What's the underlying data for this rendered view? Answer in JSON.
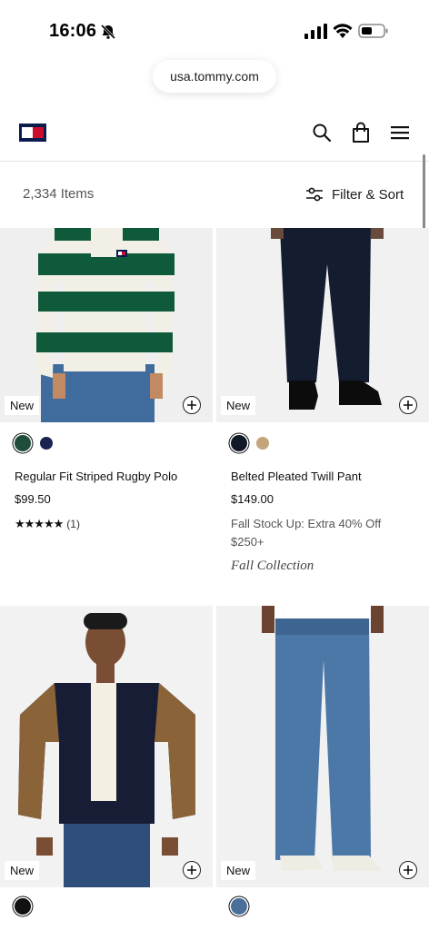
{
  "status_bar": {
    "time": "16:06"
  },
  "browser": {
    "url": "usa.tommy.com"
  },
  "header": {
    "logo": "tommy-hilfiger-flag",
    "icons": [
      "search-icon",
      "bag-icon",
      "menu-icon"
    ]
  },
  "toolbar": {
    "item_count": "2,334 Items",
    "filter_label": "Filter & Sort"
  },
  "colors": {
    "brand_navy": "#0b1b4d",
    "brand_red": "#cc0c2f",
    "green_stripe": "#0f5a3a"
  },
  "products": [
    {
      "badge": "New",
      "title": "Regular Fit Striped Rugby Polo",
      "price": "$99.50",
      "stars": "★★★★★",
      "review_count": "(1)",
      "swatches": [
        "#1e4d3a",
        "#1b2350"
      ]
    },
    {
      "badge": "New",
      "title": "Belted Pleated Twill Pant",
      "price": "$149.00",
      "promo": "Fall Stock Up: Extra 40% Off $250+",
      "collection": "Fall Collection",
      "swatches": [
        "#111827",
        "#c3a47c"
      ]
    },
    {
      "badge": "New",
      "swatches": [
        "#111111"
      ]
    },
    {
      "badge": "New",
      "swatches": [
        "#4a6f9a"
      ]
    }
  ]
}
